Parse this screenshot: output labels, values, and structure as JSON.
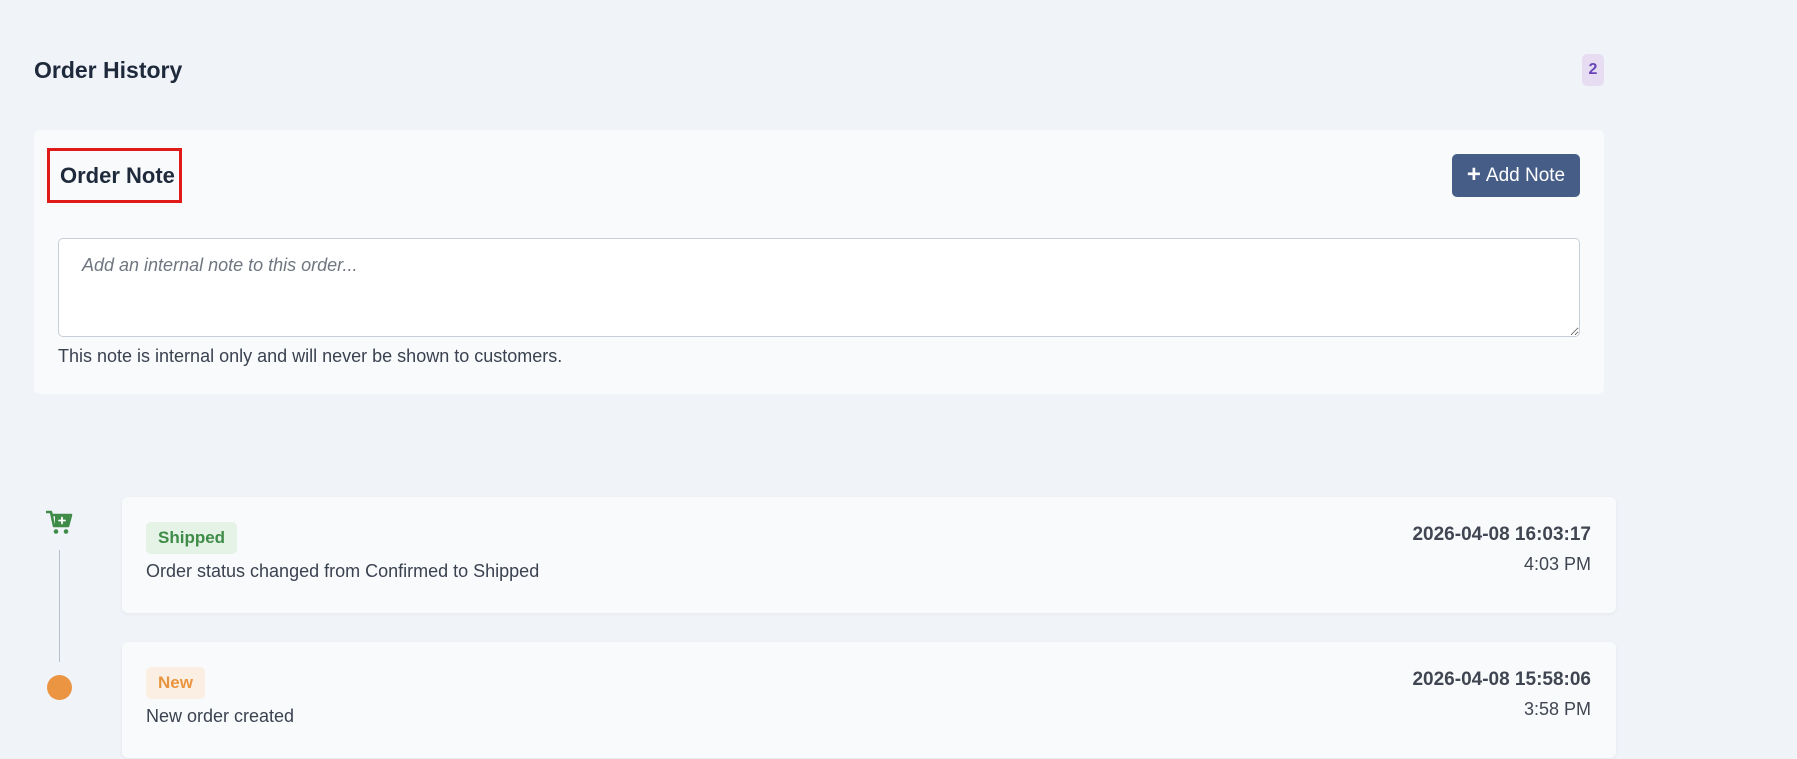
{
  "header": {
    "title": "Order History",
    "count": "2"
  },
  "order_note": {
    "title": "Order Note",
    "add_button_label": "Add Note",
    "placeholder": "Add an internal note to this order...",
    "help_text": "This note is internal only and will never be shown to customers."
  },
  "timeline": {
    "events": [
      {
        "status": "Shipped",
        "status_color": "#3f8c48",
        "icon": "add-to-cart-icon",
        "description": "Order status changed from Confirmed to Shipped",
        "datetime": "2026-04-08 16:03:17",
        "time": "4:03 PM"
      },
      {
        "status": "New",
        "status_color": "#e99540",
        "icon": "dot-icon",
        "description": "New order created",
        "datetime": "2026-04-08 15:58:06",
        "time": "3:58 PM"
      }
    ]
  },
  "colors": {
    "background": "#f0f3f8",
    "card": "#f8fafc",
    "primary_button": "#465e87",
    "highlight_box": "#e01919",
    "count_badge": "#6a45b8"
  }
}
